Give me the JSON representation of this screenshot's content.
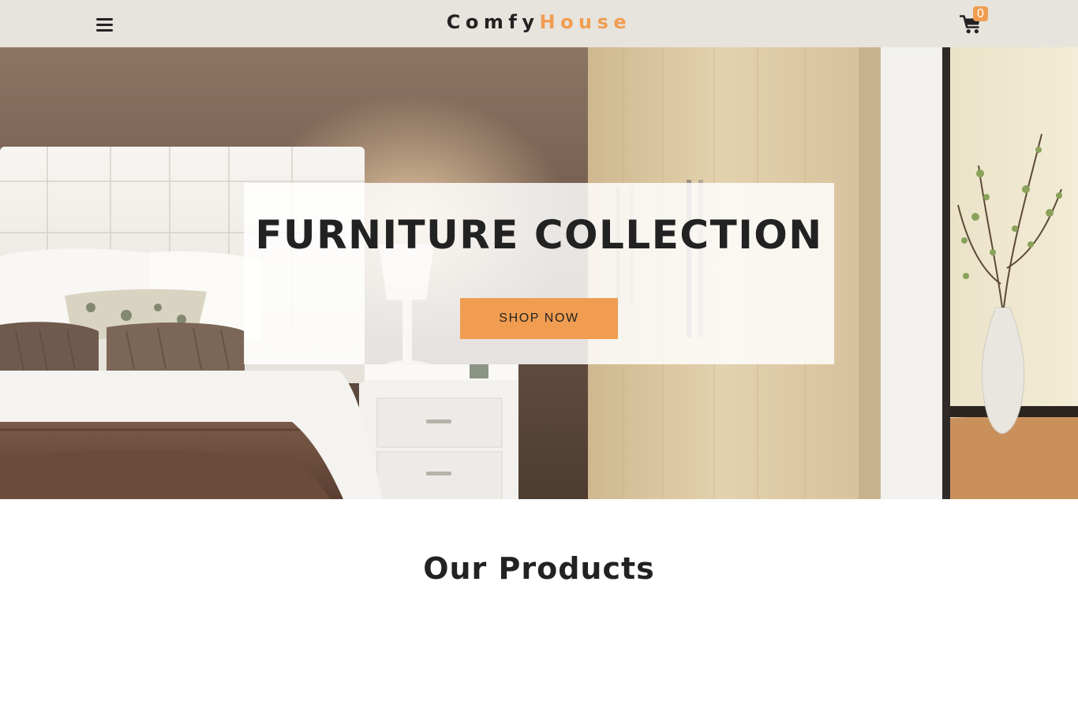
{
  "navbar": {
    "menu_icon": "hamburger-menu-icon",
    "logo": {
      "part1": "Comfy",
      "part2": "House"
    },
    "cart": {
      "icon": "shopping-cart-icon",
      "count": "0"
    }
  },
  "hero": {
    "image": "bedroom-photo",
    "title": "FURNITURE COLLECTION",
    "button_label": "SHOP NOW"
  },
  "products": {
    "title": "Our Products"
  },
  "colors": {
    "navbar_bg": "#e7e3dd",
    "accent": "#f09d51",
    "text_dark": "#222222",
    "banner_bg": "rgba(255,255,255,0.84)"
  }
}
